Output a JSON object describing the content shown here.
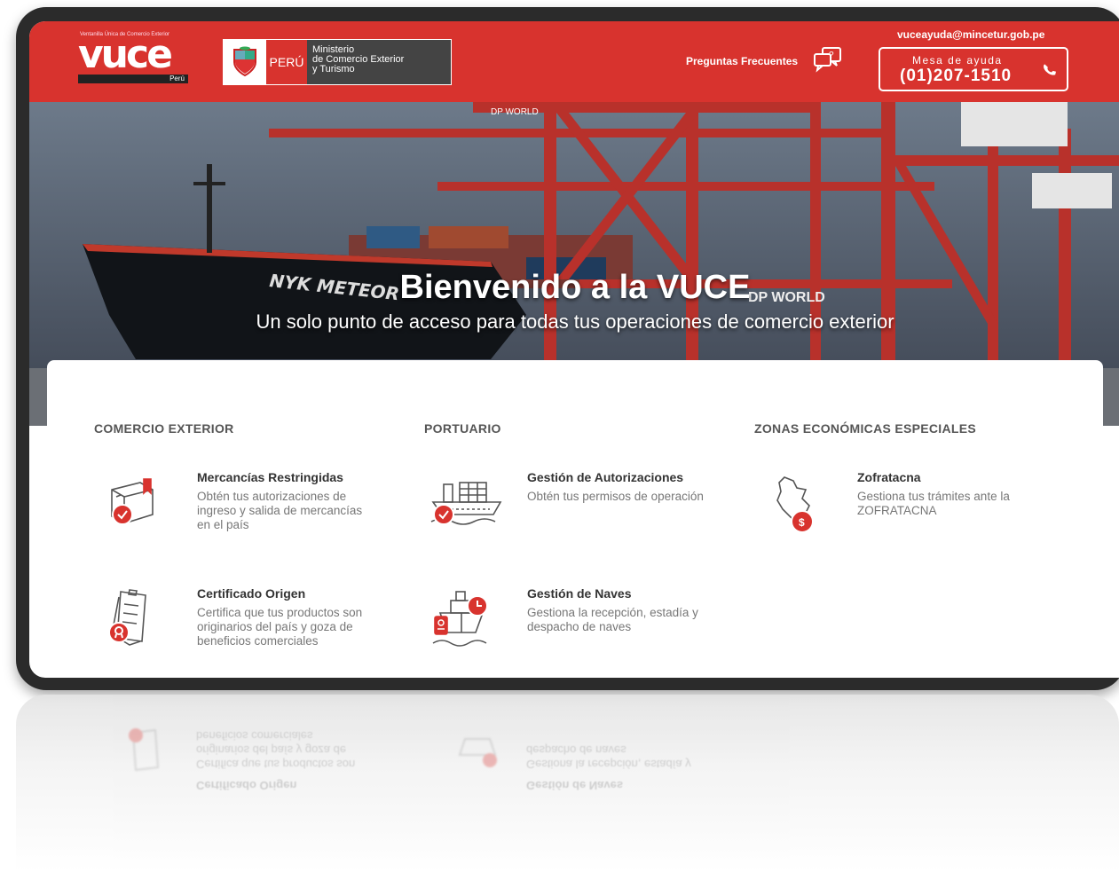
{
  "header": {
    "logo_tagline": "Ventanilla Única de Comercio Exterior",
    "logo_word": "vuce",
    "logo_country": "Perú",
    "peru_label": "PERÚ",
    "ministry_line1": "Ministerio",
    "ministry_line2": "de Comercio Exterior",
    "ministry_line3": "y Turismo",
    "faq_label": "Preguntas Frecuentes",
    "help_email": "vuceayuda@mincetur.gob.pe",
    "help_label": "Mesa de ayuda",
    "help_phone": "(01)207-1510",
    "brand_color": "#d8332e"
  },
  "hero": {
    "title": "Bienvenido a la VUCE",
    "subtitle": "Un solo punto de acceso para todas tus operaciones de comercio exterior",
    "ship_name": "NYK METEOR",
    "crane_label": "DP WORLD"
  },
  "columns": [
    {
      "heading": "COMERCIO EXTERIOR",
      "services": [
        {
          "title": "Mercancías Restringidas",
          "desc": "Obtén tus autorizaciones de ingreso y salida de mercancías en el país",
          "icon": "box-check-icon"
        },
        {
          "title": "Certificado Origen",
          "desc": "Certifica que tus productos son originarios del país y goza de beneficios comerciales",
          "icon": "certificate-icon"
        }
      ]
    },
    {
      "heading": "PORTUARIO",
      "services": [
        {
          "title": "Gestión de Autorizaciones",
          "desc": "Obtén tus permisos de operación",
          "icon": "cargo-ship-check-icon"
        },
        {
          "title": "Gestión de Naves",
          "desc": "Gestiona la recepción, estadía y despacho de naves",
          "icon": "ship-clock-icon"
        }
      ]
    },
    {
      "heading": "ZONAS ECONÓMICAS ESPECIALES",
      "services": [
        {
          "title": "Zofratacna",
          "desc": "Gestiona tus trámites ante la ZOFRATACNA",
          "icon": "peru-map-dollar-icon"
        }
      ]
    }
  ]
}
